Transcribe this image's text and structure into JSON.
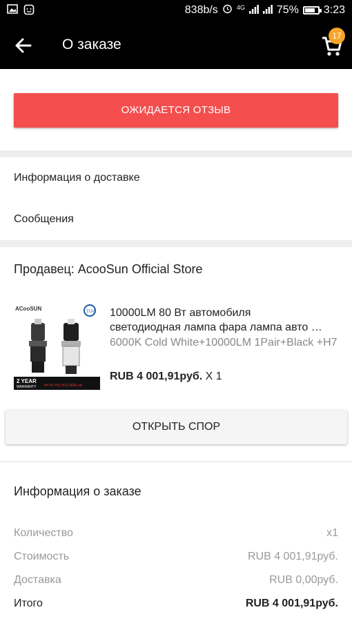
{
  "status_bar": {
    "speed": "838b/s",
    "network": "4G",
    "battery": "75%",
    "battery_level": 0.75,
    "time": "3:23"
  },
  "app_bar": {
    "title": "О заказе",
    "cart_count": "17"
  },
  "order_status": {
    "label": "ОЖИДАЕТСЯ ОТЗЫВ",
    "color": "#f44e4e"
  },
  "links": {
    "delivery_info": "Информация о доставке",
    "messages": "Сообщения"
  },
  "seller": {
    "label": "Продавец: AcooSun Official Store"
  },
  "product": {
    "title_line1": "10000LM 80 Вт автомобиля",
    "title_line2": "светодиодная лампа фара лампа авто …",
    "variant": "6000K Cold White+10000LM 1Pair+Black +H7",
    "price": "RUB 4 001,91руб.",
    "quantity": "X 1",
    "image_brand": "ACooSUN",
    "image_year": "2 YEAR",
    "image_warranty": "WARRANTY",
    "image_models": "H4  H7  H11  H13  9005.etc"
  },
  "dispute_button": "ОТКРЫТЬ СПОР",
  "order_info": {
    "title": "Информация о заказе",
    "rows": [
      {
        "label": "Количество",
        "value": "x1"
      },
      {
        "label": "Стоимость",
        "value": "RUB 4 001,91руб."
      },
      {
        "label": "Доставка",
        "value": "RUB 0,00руб."
      },
      {
        "label": "Итого",
        "value": "RUB 4 001,91руб."
      }
    ]
  }
}
